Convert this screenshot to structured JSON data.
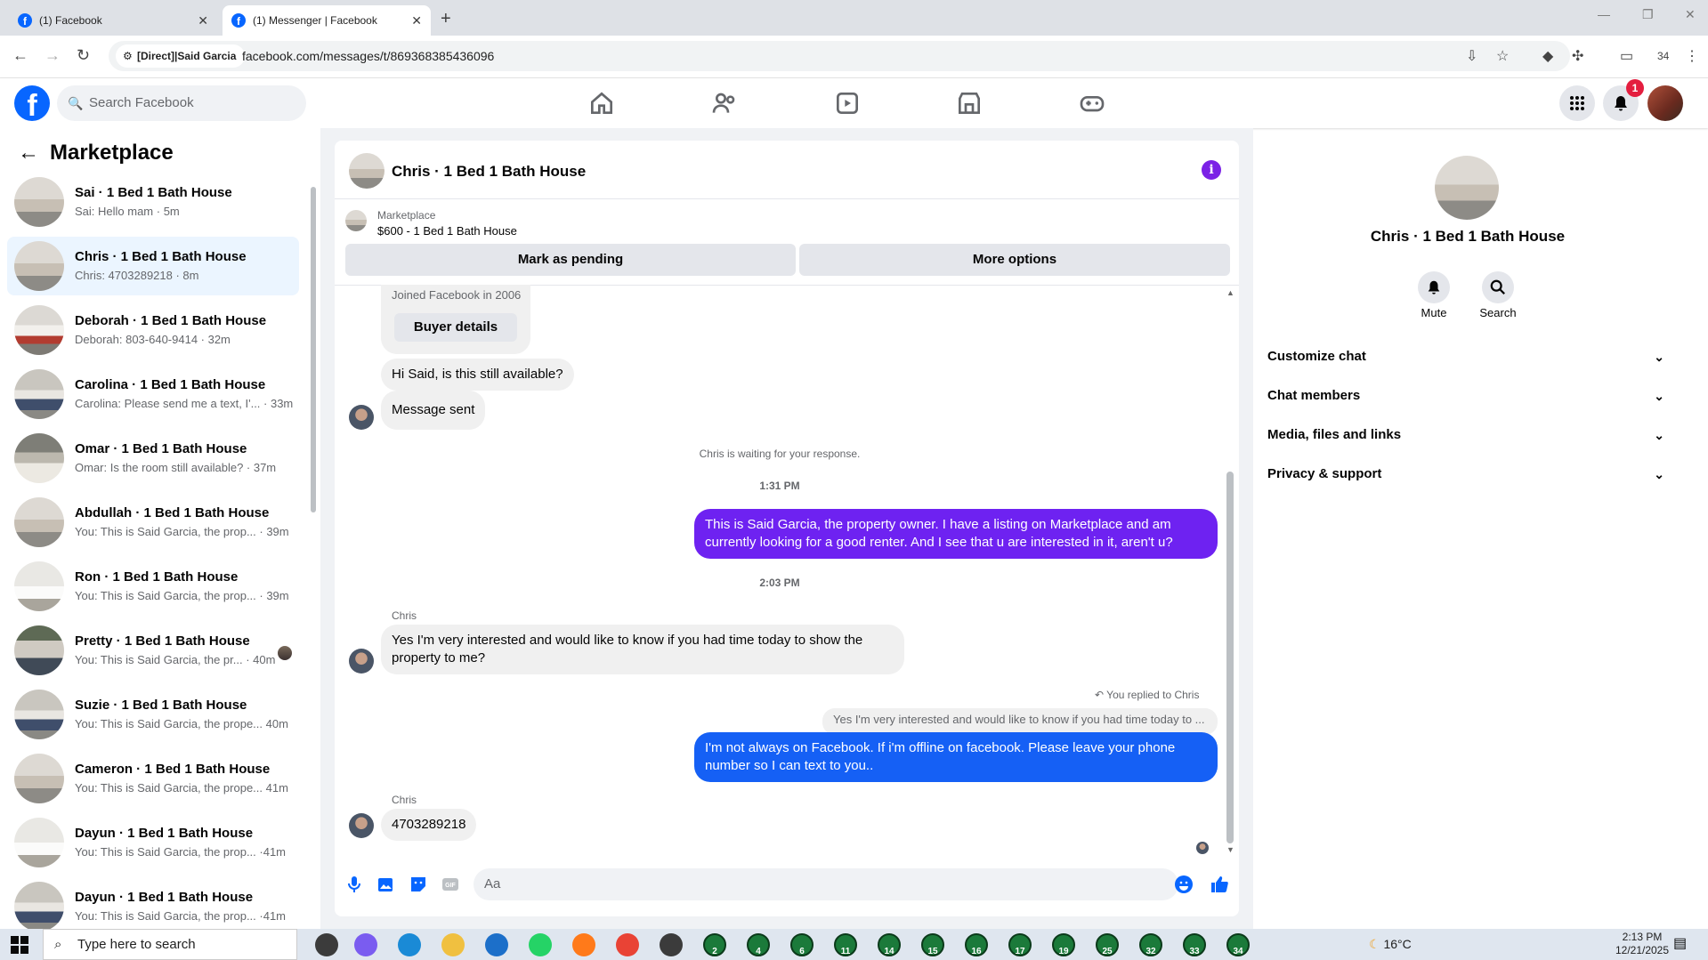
{
  "browser": {
    "tabs": [
      {
        "title": "(1) Facebook",
        "active": false
      },
      {
        "title": "(1) Messenger | Facebook",
        "active": true
      }
    ],
    "site_chip": "[Direct]|Said Garcia",
    "url": "facebook.com/messages/t/869368385436096",
    "profile_count": "34"
  },
  "fb": {
    "search_placeholder": "Search Facebook",
    "notification_count": "1"
  },
  "left": {
    "title": "Marketplace",
    "conversations": [
      {
        "name": "Sai · 1 Bed 1 Bath House",
        "preview": "Sai: Hello mam · 5m",
        "thumb": "a"
      },
      {
        "name": "Chris · 1 Bed 1 Bath House",
        "preview": "Chris: 4703289218 · 8m",
        "thumb": "a",
        "selected": true
      },
      {
        "name": "Deborah · 1 Bed 1 Bath House",
        "preview": "Deborah: 803-640-9414 · 32m",
        "thumb": "b"
      },
      {
        "name": "Carolina · 1 Bed 1 Bath House",
        "preview": "Carolina: Please send me a text, I'... · 33m",
        "thumb": "c"
      },
      {
        "name": "Omar · 1 Bed 1 Bath House",
        "preview": "Omar: Is the room still available? · 37m",
        "thumb": "d"
      },
      {
        "name": "Abdullah · 1 Bed 1 Bath House",
        "preview": "You: This is Said Garcia, the prop... · 39m",
        "thumb": "a"
      },
      {
        "name": "Ron · 1 Bed 1 Bath House",
        "preview": "You: This is Said Garcia, the prop... · 39m",
        "thumb": "e"
      },
      {
        "name": "Pretty · 1 Bed 1 Bath House",
        "preview": "You: This is Said Garcia, the pr... · 40m",
        "thumb": "f",
        "seen": true
      },
      {
        "name": "Suzie · 1 Bed 1 Bath House",
        "preview": "You: This is Said Garcia, the prope... 40m",
        "thumb": "c"
      },
      {
        "name": "Cameron · 1 Bed 1 Bath House",
        "preview": "You: This is Said Garcia, the prope... 41m",
        "thumb": "a"
      },
      {
        "name": "Dayun · 1 Bed 1 Bath House",
        "preview": "You: This is Said Garcia, the prop... ·41m",
        "thumb": "e"
      },
      {
        "name": "Dayun · 1 Bed 1 Bath House",
        "preview": "You: This is Said Garcia, the prop... ·41m",
        "thumb": "c"
      }
    ]
  },
  "chat": {
    "header_name": "Chris · 1 Bed 1 Bath House",
    "marketplace_label": "Marketplace",
    "listing": "$600 - 1 Bed 1 Bath House",
    "mark_pending": "Mark as pending",
    "more_options": "More options",
    "joined": "Joined Facebook in 2006",
    "buyer_details": "Buyer details",
    "msg_still_available": "Hi Said, is this still available?",
    "msg_sent": "Message sent",
    "waiting": "Chris is waiting for your response.",
    "time1": "1:31 PM",
    "out1": "This is Said Garcia, the property owner. I have a listing on Marketplace and am currently looking for a good renter. And I see that u are interested in it, aren't u?",
    "time2": "2:03 PM",
    "sender": "Chris",
    "in1": "Yes I'm very interested and would like to know if you had time today to show the property to me?",
    "replied_label": "You replied to Chris",
    "reply_quote": "Yes I'm very interested and would like to know if you had time today to ...",
    "out2": "I'm not always on Facebook. If i'm offline on facebook. Please leave your phone number so I can text to you..",
    "sender2": "Chris",
    "in2": "4703289218",
    "composer_placeholder": "Aa",
    "colors": {
      "purple": "#7b22e6",
      "blue": "#0866ff",
      "out1": "#6e22f1",
      "out2": "#1560f5"
    }
  },
  "right": {
    "name": "Chris · 1 Bed 1 Bath House",
    "mute": "Mute",
    "search": "Search",
    "sections": [
      "Customize chat",
      "Chat members",
      "Media, files and links",
      "Privacy & support"
    ]
  },
  "taskbar": {
    "search_placeholder": "Type here to search",
    "temp": "16°C",
    "time": "2:13 PM",
    "date": "12/21/2025",
    "badges": [
      "2",
      "4",
      "6",
      "11",
      "14",
      "15",
      "16",
      "17",
      "19",
      "25",
      "32",
      "33",
      "34"
    ]
  }
}
